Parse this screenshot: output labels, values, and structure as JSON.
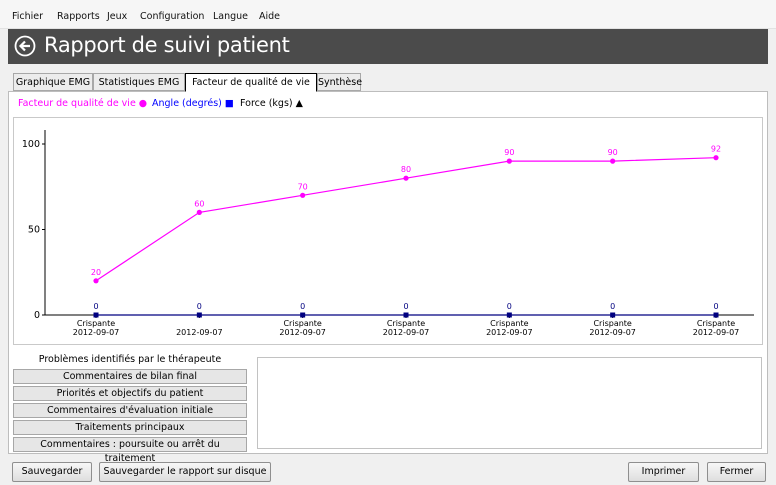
{
  "menu": [
    "Fichier",
    "Rapports",
    "Jeux",
    "Configuration",
    "Langue",
    "Aide"
  ],
  "title": "Rapport de suivi patient",
  "tabs": [
    "Graphique EMG",
    "Statistiques EMG",
    "Facteur de qualité de vie",
    "Synthèse"
  ],
  "active_tab": "Facteur de qualité de vie",
  "legend": [
    {
      "label": "Facteur de qualité de vie ●",
      "color": "#ff00ff"
    },
    {
      "label": "Angle (degrés) ■",
      "color": "#0000ff"
    },
    {
      "label": "Force (kgs) ▲",
      "color": "#000000"
    }
  ],
  "chart_data": {
    "type": "line",
    "x": [
      1,
      2,
      3,
      4,
      5,
      6,
      7
    ],
    "x_labels": [
      [
        "Crispante",
        "2012-09-07"
      ],
      [
        "",
        "2012-09-07"
      ],
      [
        "Crispante",
        "2012-09-07"
      ],
      [
        "Crispante",
        "2012-09-07"
      ],
      [
        "Crispante",
        "2012-09-07"
      ],
      [
        "Crispante",
        "2012-09-07"
      ],
      [
        "Crispante",
        "2012-09-07"
      ]
    ],
    "series": [
      {
        "name": "Facteur de qualité de vie",
        "color": "#ff00ff",
        "marker": "circle",
        "values": [
          20,
          60,
          70,
          80,
          90,
          90,
          92
        ],
        "labels": [
          "20",
          "60",
          "70",
          "80",
          "90",
          "90",
          "92"
        ]
      },
      {
        "name": "Angle (degrés)",
        "color": "#000080",
        "marker": "square",
        "values": [
          0,
          0,
          0,
          0,
          0,
          0,
          0
        ],
        "labels": [
          "0",
          "0",
          "0",
          "0",
          "0",
          "0",
          "0"
        ]
      }
    ],
    "y_ticks": [
      0,
      50,
      100
    ],
    "y_tick_labels": [
      "0",
      "50",
      "100"
    ],
    "ylim": [
      0,
      100
    ],
    "grid": false
  },
  "bottom_tabs": [
    "Problèmes identifiés par le thérapeute",
    "Commentaires de bilan final",
    "Priorités et objectifs du patient",
    "Commentaires d'évaluation initiale",
    "Traitements principaux",
    "Commentaires : poursuite ou arrêt du traitement"
  ],
  "buttons": {
    "save": "Sauvegarder",
    "save_disk": "Sauvegarder le rapport sur disque",
    "print": "Imprimer",
    "close": "Fermer"
  }
}
